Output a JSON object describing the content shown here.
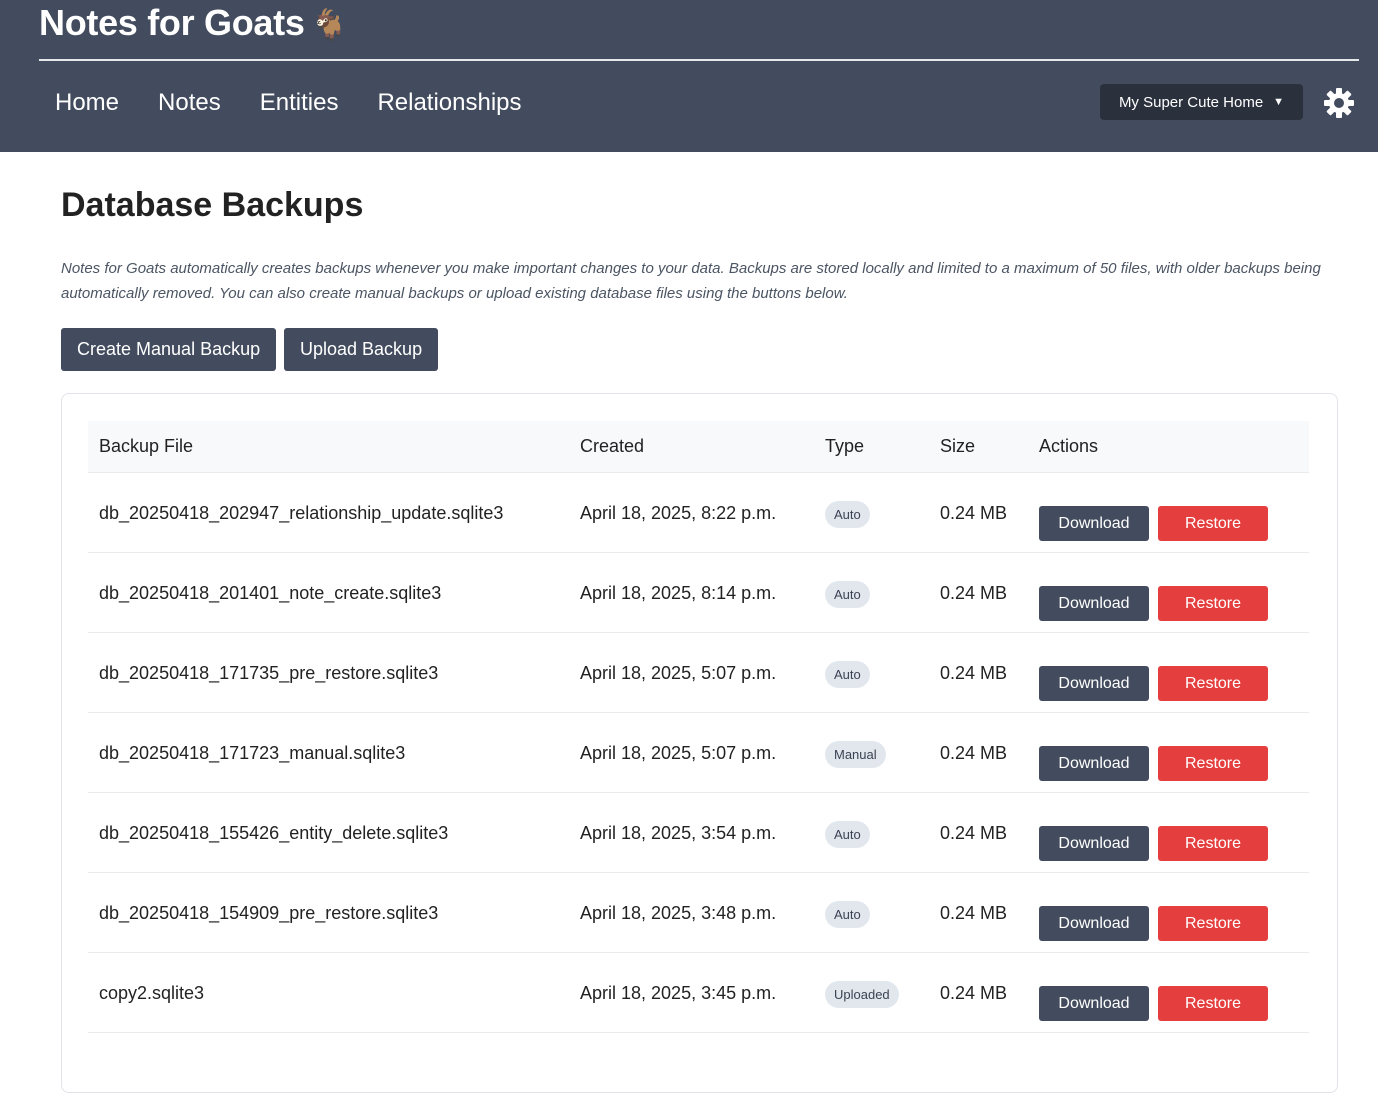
{
  "app": {
    "title": "Notes for Goats",
    "logo_glyph": "🐐"
  },
  "nav": {
    "items": [
      "Home",
      "Notes",
      "Entities",
      "Relationships"
    ]
  },
  "household_selector": {
    "label": "My Super Cute Home",
    "caret": "▼"
  },
  "page": {
    "title": "Database Backups",
    "intro": "Notes for Goats automatically creates backups whenever you make important changes to your data. Backups are stored locally and limited to a maximum of 50 files, with older backups being automatically removed. You can also create manual backups or upload existing database files using the buttons below.",
    "create_button": "Create Manual Backup",
    "upload_button": "Upload Backup"
  },
  "table": {
    "headers": [
      "Backup File",
      "Created",
      "Type",
      "Size",
      "Actions"
    ],
    "download_label": "Download",
    "restore_label": "Restore",
    "rows": [
      {
        "file": "db_20250418_202947_relationship_update.sqlite3",
        "created": "April 18, 2025, 8:22 p.m.",
        "type": "Auto",
        "size": "0.24 MB"
      },
      {
        "file": "db_20250418_201401_note_create.sqlite3",
        "created": "April 18, 2025, 8:14 p.m.",
        "type": "Auto",
        "size": "0.24 MB"
      },
      {
        "file": "db_20250418_171735_pre_restore.sqlite3",
        "created": "April 18, 2025, 5:07 p.m.",
        "type": "Auto",
        "size": "0.24 MB"
      },
      {
        "file": "db_20250418_171723_manual.sqlite3",
        "created": "April 18, 2025, 5:07 p.m.",
        "type": "Manual",
        "size": "0.24 MB"
      },
      {
        "file": "db_20250418_155426_entity_delete.sqlite3",
        "created": "April 18, 2025, 3:54 p.m.",
        "type": "Auto",
        "size": "0.24 MB"
      },
      {
        "file": "db_20250418_154909_pre_restore.sqlite3",
        "created": "April 18, 2025, 3:48 p.m.",
        "type": "Auto",
        "size": "0.24 MB"
      },
      {
        "file": "copy2.sqlite3",
        "created": "April 18, 2025, 3:45 p.m.",
        "type": "Uploaded",
        "size": "0.24 MB"
      }
    ]
  },
  "colors": {
    "header_bg": "#434c5e",
    "restore_red": "#e53e3e",
    "badge_bg": "#e2e7ee"
  },
  "icons": {
    "settings": "gear-icon",
    "dropdown": "chevron-down-icon"
  }
}
